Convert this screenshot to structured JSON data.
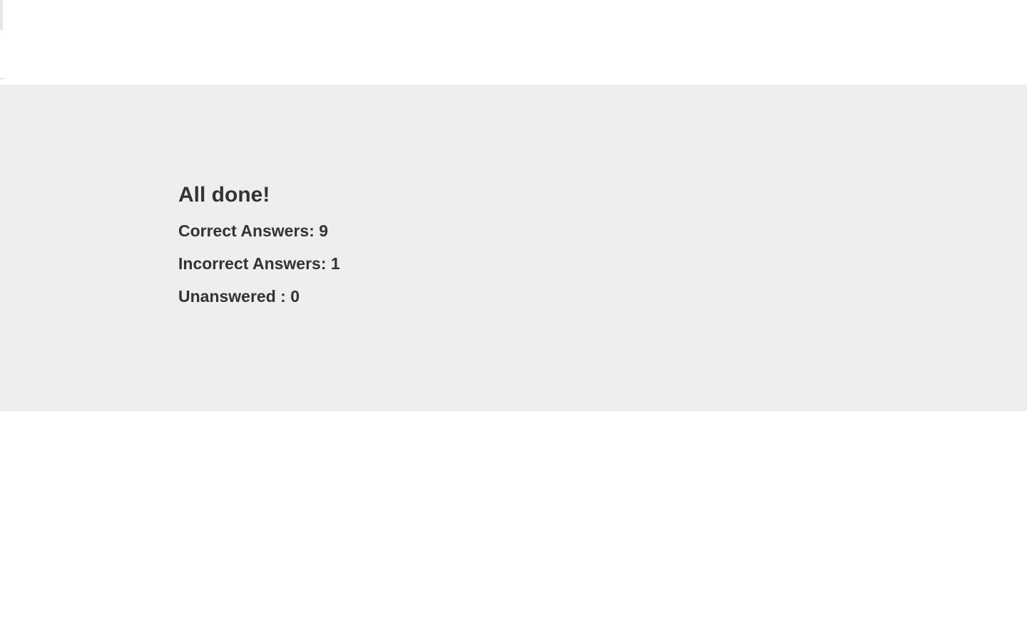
{
  "results": {
    "title": "All done!",
    "correct": "Correct Answers: 9",
    "incorrect": "Incorrect Answers: 1",
    "unanswered": "Unanswered : 0"
  },
  "colors": {
    "panel_background": "#eeeeee",
    "text": "#333333",
    "page_background": "#ffffff"
  }
}
